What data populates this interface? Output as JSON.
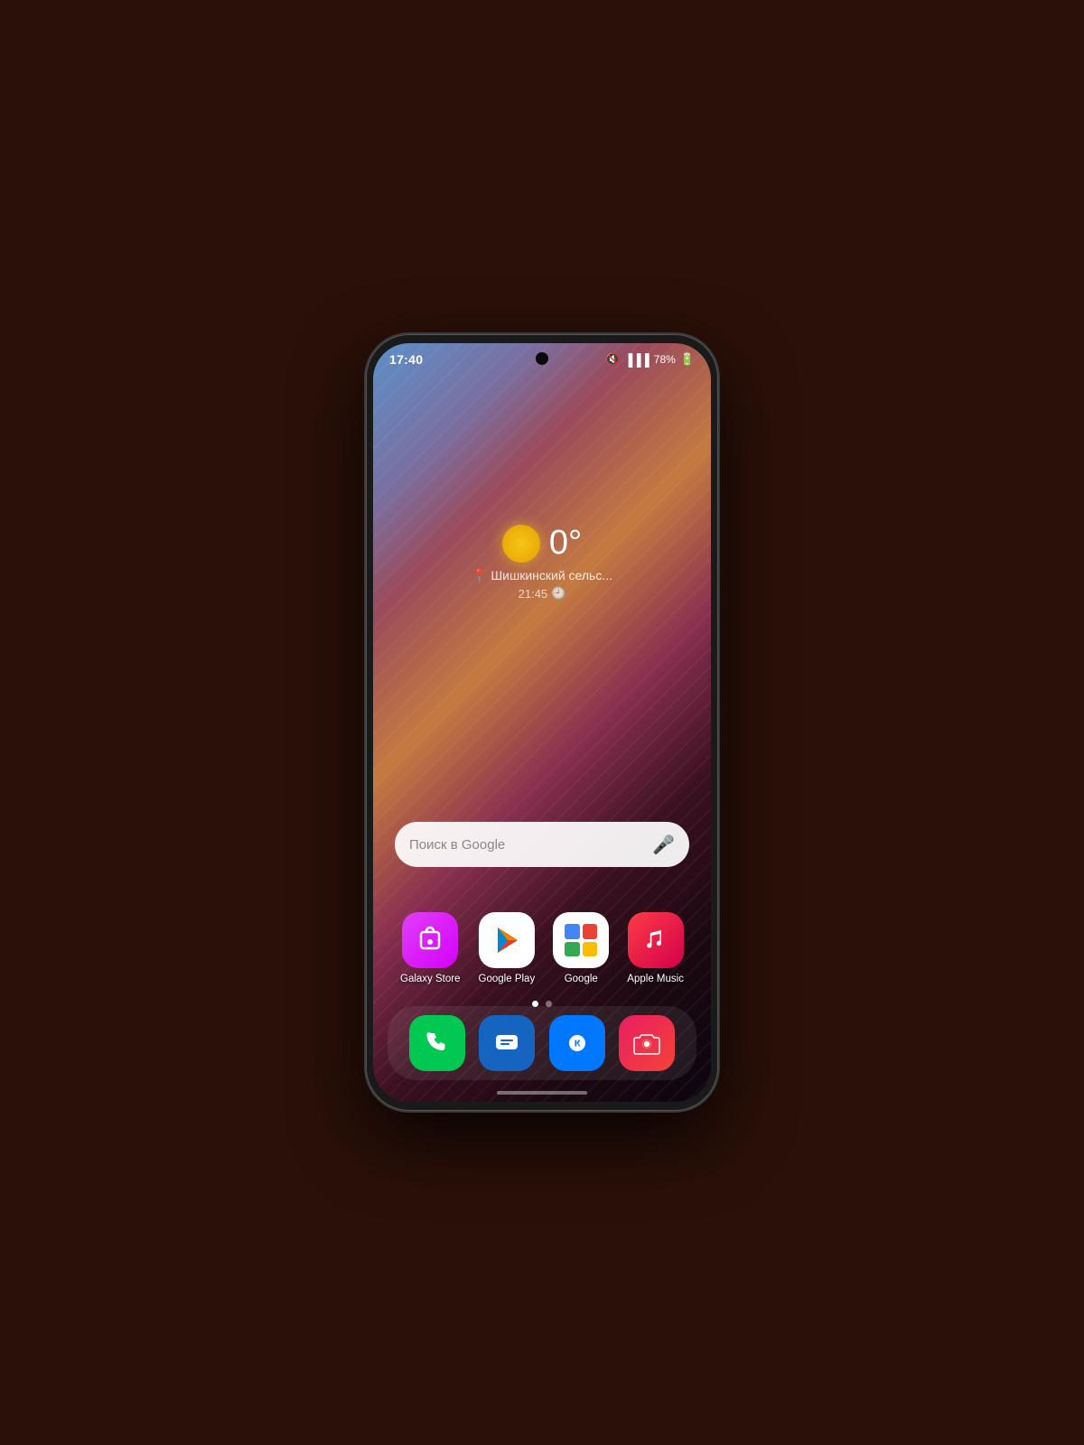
{
  "background_color": "#2a1008",
  "phone": {
    "status_bar": {
      "time": "17:40",
      "battery_percent": "78%",
      "battery_icon": "🔋",
      "signal_icon": "📶",
      "sound_icon": "🔇"
    },
    "weather": {
      "temperature": "0°",
      "location": "📍 Шишкинский сельс...",
      "time": "21:45",
      "clock_icon": "🕘"
    },
    "search": {
      "placeholder": "Поиск в Google"
    },
    "apps": [
      {
        "id": "galaxy-store",
        "label": "Galaxy Store",
        "icon_type": "galaxy"
      },
      {
        "id": "google-play",
        "label": "Google Play",
        "icon_type": "play"
      },
      {
        "id": "google",
        "label": "Google",
        "icon_type": "google"
      },
      {
        "id": "apple-music",
        "label": "Apple Music",
        "icon_type": "apple-music"
      }
    ],
    "dock_apps": [
      {
        "id": "phone",
        "label": "Phone",
        "icon_type": "phone"
      },
      {
        "id": "messages",
        "label": "Messages",
        "icon_type": "messages"
      },
      {
        "id": "vk",
        "label": "VK",
        "icon_type": "vk"
      },
      {
        "id": "camera",
        "label": "Camera",
        "icon_type": "camera"
      }
    ],
    "page_dots": {
      "active": 0,
      "total": 2
    }
  }
}
